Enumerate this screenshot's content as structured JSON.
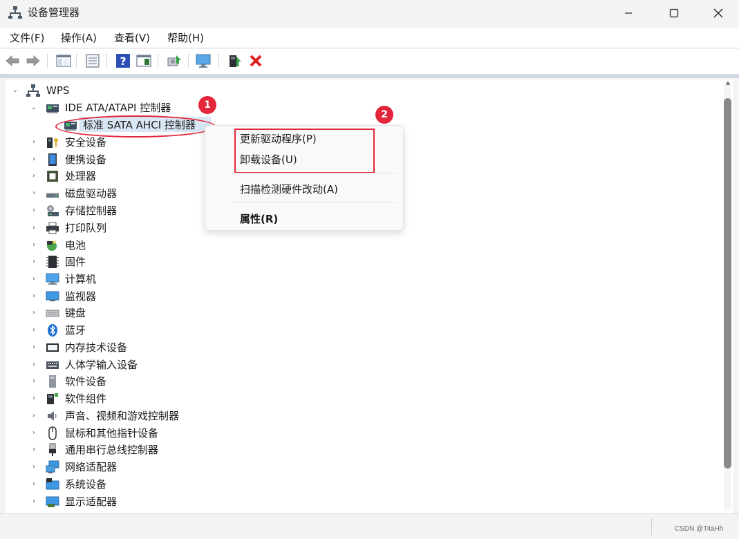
{
  "window": {
    "title": "设备管理器",
    "controls": {
      "minimize": "—",
      "maximize": "☐",
      "close": "✕"
    }
  },
  "menubar": {
    "file": "文件(F)",
    "action": "操作(A)",
    "view": "查看(V)",
    "help": "帮助(H)"
  },
  "toolbar": {
    "icons": [
      "back-arrow-icon",
      "forward-arrow-icon",
      "show-hide-console-tree-icon",
      "properties-icon",
      "help-icon",
      "action-pane-icon",
      "scan-hardware-icon",
      "monitor-icon",
      "update-driver-icon",
      "uninstall-device-icon"
    ]
  },
  "tree": {
    "root": "WPS",
    "ide_group": "IDE ATA/ATAPI 控制器",
    "selected_child": "标准 SATA AHCI 控制器",
    "categories": [
      "安全设备",
      "便携设备",
      "处理器",
      "磁盘驱动器",
      "存储控制器",
      "打印队列",
      "电池",
      "固件",
      "计算机",
      "监视器",
      "键盘",
      "蓝牙",
      "内存技术设备",
      "人体学输入设备",
      "软件设备",
      "软件组件",
      "声音、视频和游戏控制器",
      "鼠标和其他指针设备",
      "通用串行总线控制器",
      "网络适配器",
      "系统设备",
      "显示适配器"
    ]
  },
  "annotations": {
    "marker_1": "1",
    "marker_2": "2"
  },
  "context_menu": {
    "update_driver": "更新驱动程序(P)",
    "uninstall": "卸载设备(U)",
    "scan": "扫描检测硬件改动(A)",
    "properties": "属性(R)"
  },
  "statusbar": {
    "watermark": "CSDN @TitaHh"
  },
  "colors": {
    "annotation_red": "#e3263b",
    "selection": "#d9e6f3",
    "window_bg": "#f3f3f3"
  }
}
